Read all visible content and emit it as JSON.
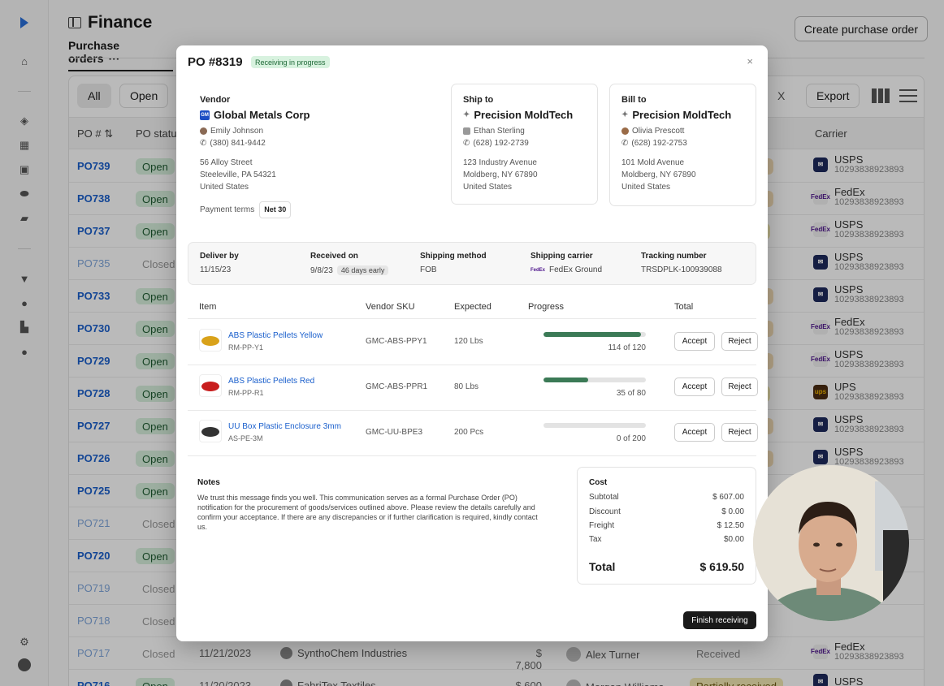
{
  "page": {
    "title": "Finance",
    "tab": "Purchase orders",
    "tab_more": "···",
    "create_button": "Create purchase order"
  },
  "filters": {
    "all": "All",
    "open": "Open",
    "clear": "X",
    "export": "Export"
  },
  "table": {
    "headers": {
      "po": "PO #",
      "status": "PO status",
      "ship_status": "s",
      "carrier": "Carrier"
    },
    "rows": [
      {
        "po": "PO739",
        "status": "Open",
        "delivery": "ent",
        "carrier": "USPS",
        "tracking": "10293838923893",
        "carrier_icon": "usps-logo"
      },
      {
        "po": "PO738",
        "status": "Open",
        "delivery": "ent",
        "carrier": "FedEx",
        "tracking": "10293838923893",
        "carrier_icon": "fedex-logo"
      },
      {
        "po": "PO737",
        "status": "Open",
        "delivery": "ed",
        "carrier": "USPS",
        "tracking": "10293838923893",
        "carrier_icon": "fedex-logo"
      },
      {
        "po": "PO735",
        "status": "Closed",
        "delivery": "",
        "carrier": "USPS",
        "tracking": "10293838923893",
        "carrier_icon": "usps-logo"
      },
      {
        "po": "PO733",
        "status": "Open",
        "delivery": "ent",
        "carrier": "USPS",
        "tracking": "10293838923893",
        "carrier_icon": "usps-logo"
      },
      {
        "po": "PO730",
        "status": "Open",
        "delivery": "ent",
        "carrier": "FedEx",
        "tracking": "10293838923893",
        "carrier_icon": "fedex-logo"
      },
      {
        "po": "PO729",
        "status": "Open",
        "delivery": "ent",
        "carrier": "USPS",
        "tracking": "10293838923893",
        "carrier_icon": "fedex-logo"
      },
      {
        "po": "PO728",
        "status": "Open",
        "delivery": "ed",
        "carrier": "UPS",
        "tracking": "10293838923893",
        "carrier_icon": "ups-logo"
      },
      {
        "po": "PO727",
        "status": "Open",
        "delivery": "ent",
        "carrier": "USPS",
        "tracking": "10293838923893",
        "carrier_icon": "usps-logo"
      },
      {
        "po": "PO726",
        "status": "Open",
        "delivery": "ent",
        "carrier": "USPS",
        "tracking": "10293838923893",
        "carrier_icon": "usps-logo"
      },
      {
        "po": "PO725",
        "status": "Open",
        "delivery": "",
        "carrier": "",
        "tracking": "",
        "carrier_icon": ""
      },
      {
        "po": "PO721",
        "status": "Closed",
        "delivery": "",
        "carrier": "",
        "tracking": "",
        "carrier_icon": ""
      },
      {
        "po": "PO720",
        "status": "Open",
        "delivery": "",
        "carrier": "",
        "tracking": "",
        "carrier_icon": ""
      },
      {
        "po": "PO719",
        "status": "Closed",
        "delivery": "",
        "carrier": "",
        "tracking": "",
        "carrier_icon": ""
      },
      {
        "po": "PO718",
        "status": "Closed",
        "delivery": "",
        "carrier": "",
        "tracking": "",
        "carrier_icon": ""
      },
      {
        "po": "PO717",
        "status": "Closed",
        "date": "11/21/2023",
        "vendor": "SynthoChem Industries",
        "amount": "$ 7,800",
        "user": "Alex Turner",
        "delivery": "Received",
        "carrier": "FedEx",
        "tracking": "10293838923893",
        "carrier_icon": "fedex-logo"
      },
      {
        "po": "PO716",
        "status": "Open",
        "date": "11/20/2023",
        "vendor": "FabriTex Textiles",
        "amount": "$ 600",
        "user": "Morgan Williams",
        "delivery": "Partially received",
        "carrier": "USPS",
        "tracking": "",
        "carrier_icon": "usps-logo"
      }
    ]
  },
  "modal": {
    "title": "PO #8319",
    "badge": "Receiving in progress",
    "close": "×",
    "vendor": {
      "heading": "Vendor",
      "name": "Global Metals Corp",
      "contact": "Emily Johnson",
      "phone": "(380) 841-9442",
      "addr1": "56 Alloy Street",
      "addr2": "Steeleville, PA 54321",
      "addr3": "United States",
      "terms_label": "Payment terms",
      "terms": "Net 30"
    },
    "ship_to": {
      "heading": "Ship to",
      "name": "Precision MoldTech",
      "contact": "Ethan Sterling",
      "phone": "(628) 192-2739",
      "addr1": "123 Industry Avenue",
      "addr2": "Moldberg, NY 67890",
      "addr3": "United States"
    },
    "bill_to": {
      "heading": "Bill to",
      "name": "Precision MoldTech",
      "contact": "Olivia Prescott",
      "phone": "(628) 192-2753",
      "addr1": "101 Mold Avenue",
      "addr2": "Moldberg, NY 67890",
      "addr3": "United States"
    },
    "shipping": {
      "deliver_by_label": "Deliver by",
      "deliver_by": "11/15/23",
      "received_label": "Received on",
      "received": "9/8/23",
      "early": "46 days early",
      "method_label": "Shipping method",
      "method": "FOB",
      "carrier_label": "Shipping carrier",
      "carrier": "FedEx Ground",
      "tracking_label": "Tracking number",
      "tracking": "TRSDPLK-100939088"
    },
    "items_headers": {
      "item": "Item",
      "vendor_sku": "Vendor SKU",
      "expected": "Expected",
      "progress": "Progress",
      "total": "Total"
    },
    "items": [
      {
        "name": "ABS Plastic Pellets Yellow",
        "sku": "RM-PP-Y1",
        "vendor_sku": "GMC-ABS-PPY1",
        "expected": "120 Lbs",
        "progress_text": "114 of 120",
        "progress": 0.95,
        "accept": "Accept",
        "reject": "Reject",
        "thumb_color": "#d9a21a"
      },
      {
        "name": "ABS Plastic Pellets Red",
        "sku": "RM-PP-R1",
        "vendor_sku": "GMC-ABS-PPR1",
        "expected": "80 Lbs",
        "progress_text": "35 of 80",
        "progress": 0.4375,
        "accept": "Accept",
        "reject": "Reject",
        "thumb_color": "#c81d1d"
      },
      {
        "name": "UU Box Plastic Enclosure 3mm",
        "sku": "AS-PE-3M",
        "vendor_sku": "GMC-UU-BPE3",
        "expected": "200 Pcs",
        "progress_text": "0 of 200",
        "progress": 0,
        "accept": "Accept",
        "reject": "Reject",
        "thumb_color": "#333333"
      }
    ],
    "notes": {
      "heading": "Notes",
      "text": "We trust this message finds you well. This communication serves as a formal Purchase Order (PO) notification for the procurement of goods/services outlined above. Please review the details carefully and confirm your acceptance. If there are any discrepancies or if further clarification is required, kindly contact us."
    },
    "cost": {
      "heading": "Cost",
      "subtotal_label": "Subtotal",
      "subtotal": "$ 607.00",
      "discount_label": "Discount",
      "discount": "$ 0.00",
      "freight_label": "Freight",
      "freight": "$ 12.50",
      "tax_label": "Tax",
      "tax": "$0.00",
      "total_label": "Total",
      "total": "$ 619.50"
    },
    "finish": "Finish receiving"
  }
}
